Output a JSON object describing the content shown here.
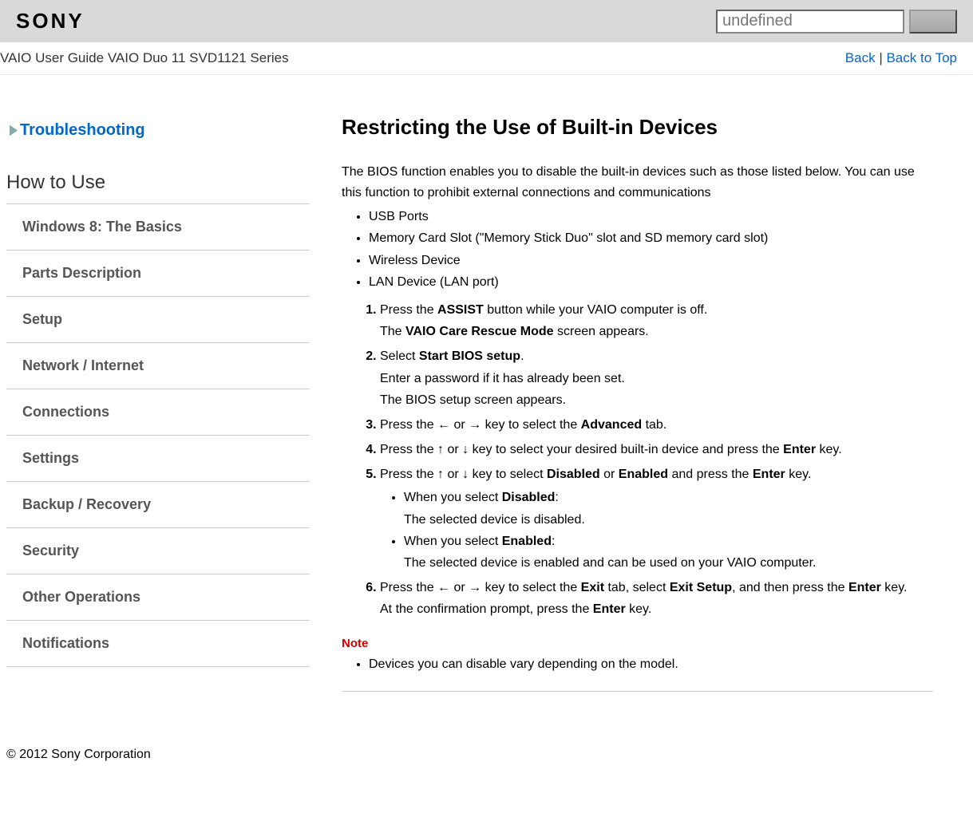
{
  "header": {
    "brand": "SONY",
    "search_placeholder": "undefined"
  },
  "breadcrumb": {
    "guide": "VAIO User Guide",
    "model": "VAIO Duo 11 SVD1121 Series",
    "back": "Back",
    "sep": " | ",
    "back_to_top": "Back to Top"
  },
  "sidebar": {
    "troubleshooting": "Troubleshooting",
    "how_to_use": "How to Use",
    "items": [
      "Windows 8: The Basics",
      "Parts Description",
      "Setup",
      "Network / Internet",
      "Connections",
      "Settings",
      "Backup / Recovery",
      "Security",
      "Other Operations",
      "Notifications"
    ]
  },
  "article": {
    "title": "Restricting the Use of Built-in Devices",
    "intro": "The BIOS function enables you to disable the built-in devices such as those listed below. You can use this function to prohibit external connections and communications",
    "devices": [
      "USB Ports",
      "Memory Card Slot (\"Memory Stick Duo\" slot and SD memory card slot)",
      "Wireless Device",
      "LAN Device (LAN port)"
    ],
    "steps": {
      "s1a": "Press the ",
      "s1b": "ASSIST",
      "s1c": " button while your VAIO computer is off.",
      "s1d_a": "The ",
      "s1d_b": "VAIO Care Rescue Mode",
      "s1d_c": " screen appears.",
      "s2a": "Select ",
      "s2b": "Start BIOS setup",
      "s2c": ".",
      "s2d": "Enter a password if it has already been set.",
      "s2e": "The BIOS setup screen appears.",
      "s3a": "Press the ",
      "s3b": " or ",
      "s3c": " key to select the ",
      "s3d": "Advanced",
      "s3e": " tab.",
      "s4a": "Press the ",
      "s4b": " or ",
      "s4c": " key to select your desired built-in device and press the ",
      "s4d": "Enter",
      "s4e": " key.",
      "s5a": "Press the ",
      "s5b": " or ",
      "s5c": " key to select ",
      "s5d": "Disabled",
      "s5e": " or ",
      "s5f": "Enabled",
      "s5g": " and press the ",
      "s5h": "Enter",
      "s5i": " key.",
      "s5_sub1a": "When you select ",
      "s5_sub1b": "Disabled",
      "s5_sub1c": ":",
      "s5_sub1d": "The selected device is disabled.",
      "s5_sub2a": "When you select ",
      "s5_sub2b": "Enabled",
      "s5_sub2c": ":",
      "s5_sub2d": "The selected device is enabled and can be used on your VAIO computer.",
      "s6a": "Press the ",
      "s6b": " or ",
      "s6c": " key to select the ",
      "s6d": "Exit",
      "s6e": " tab, select ",
      "s6f": "Exit Setup",
      "s6g": ", and then press the ",
      "s6h": "Enter",
      "s6i": " key.",
      "s6j": "At the confirmation prompt, press the ",
      "s6k": "Enter",
      "s6l": " key."
    },
    "note_label": "Note",
    "note_item": "Devices you can disable vary depending on the model."
  },
  "glyphs": {
    "left": "←",
    "right": "→",
    "up": "↑",
    "down": "↓"
  },
  "footer": {
    "copyright": "© 2012 Sony Corporation"
  }
}
